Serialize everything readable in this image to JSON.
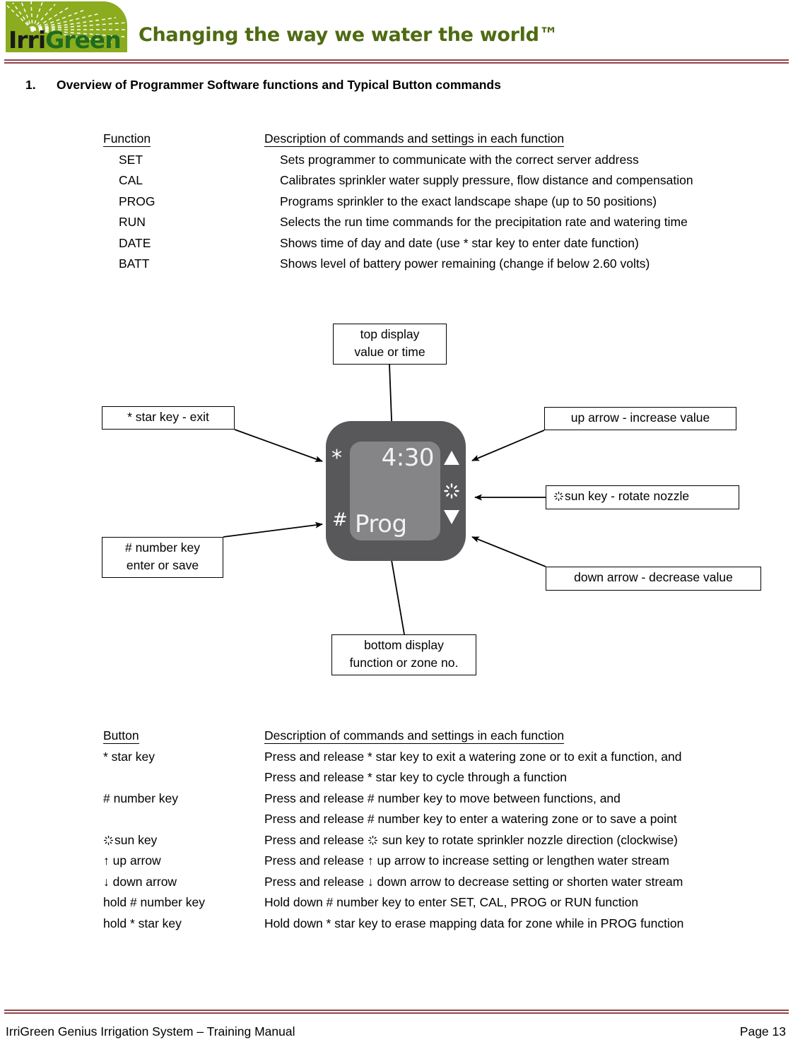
{
  "header": {
    "logo_text_part1": "Irri",
    "logo_text_part2": "Green",
    "logo_icon": "sprinkler-spray-icon",
    "tagline": "Changing the way we water the world™",
    "brand_green": "#8aac1e",
    "rule_color": "#92434a"
  },
  "section": {
    "number": "1.",
    "title": "Overview of Programmer Software functions and Typical Button commands"
  },
  "function_table": {
    "header": {
      "col_a": "Function",
      "col_b": "Description of commands and settings in each function"
    },
    "rows": [
      {
        "col_a": "SET",
        "col_b": "Sets programmer to communicate with the correct server address"
      },
      {
        "col_a": "CAL",
        "col_b": "Calibrates sprinkler water supply pressure, flow distance and compensation"
      },
      {
        "col_a": "PROG",
        "col_b": "Programs sprinkler to the exact landscape shape (up to 50 positions)"
      },
      {
        "col_a": "RUN",
        "col_b": "Selects the run time commands for the precipitation rate and watering time"
      },
      {
        "col_a": "DATE",
        "col_b": "Shows time of day and date (use * star key to enter date function)"
      },
      {
        "col_a": "BATT",
        "col_b": "Shows level of battery power remaining (change if below 2.60 volts)"
      }
    ]
  },
  "diagram": {
    "device": {
      "body_color": "#58585a",
      "screen_color": "#858587",
      "display_top": "4:30",
      "display_bottom": "Prog",
      "key_star": "*",
      "key_hash": "#",
      "key_up_icon": "up-triangle-icon",
      "key_down_icon": "down-triangle-icon",
      "key_sun_icon": "sun-icon"
    },
    "callouts": {
      "top_display": {
        "line1": "top display",
        "line2": "value or time"
      },
      "star_key": {
        "line1": "* star key - exit"
      },
      "hash_key": {
        "line1": "# number key",
        "line2": "enter or save"
      },
      "up_arrow": {
        "line1": "up arrow - increase value"
      },
      "sun_key": {
        "line1": "sun key - rotate nozzle"
      },
      "down_arrow": {
        "line1": "down arrow - decrease value"
      },
      "bottom_display": {
        "line1": "bottom display",
        "line2": "function or zone no."
      }
    }
  },
  "button_table": {
    "header": {
      "col_a": "Button",
      "col_b": "Description of commands and settings in each function"
    },
    "rows": [
      {
        "col_a": "* star key",
        "col_b": "Press and release * star key to exit a watering zone or to exit a function, and"
      },
      {
        "col_a": "",
        "col_b": "Press and release * star key to cycle through a function"
      },
      {
        "col_a": "# number key",
        "col_b": "Press and release # number key to move between functions, and"
      },
      {
        "col_a": "",
        "col_b": "Press and release # number key to enter a watering zone or to save a point"
      },
      {
        "col_a": "sun key",
        "col_a_icon": "sun-icon",
        "col_b_pre": "Press and release ",
        "col_b_icon": "sun-icon",
        "col_b_post": " sun key to rotate sprinkler nozzle direction (clockwise)"
      },
      {
        "col_a": "↑ up arrow",
        "col_b": "Press and release ↑ up arrow to increase setting or lengthen water stream"
      },
      {
        "col_a": "↓ down arrow",
        "col_b": "Press and release ↓ down arrow to decrease setting or shorten water stream"
      },
      {
        "col_a": "hold # number key",
        "col_b": "Hold down # number key to enter SET, CAL, PROG or RUN function"
      },
      {
        "col_a": "hold * star key",
        "col_b": "Hold down * star key to erase mapping data for zone while in PROG function"
      }
    ]
  },
  "footer": {
    "left": "IrriGreen Genius Irrigation System – Training Manual",
    "right": "Page 13"
  }
}
